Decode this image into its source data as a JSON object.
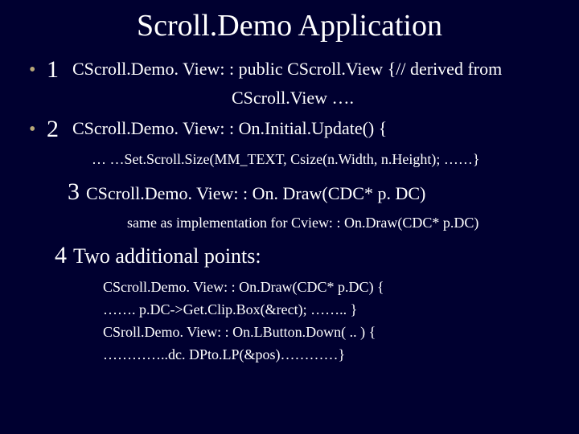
{
  "title": "Scroll.Demo Application",
  "items": {
    "i1": {
      "num": "1",
      "text": "CScroll.Demo. View: : public CScroll.View {// derived from",
      "cont": "CScroll.View …."
    },
    "i2": {
      "num": "2",
      "text": "CScroll.Demo. View: : On.Initial.Update() {",
      "sub": "… …Set.Scroll.Size(MM_TEXT, Csize(n.Width, n.Height);  ……}"
    },
    "i3": {
      "num": "3",
      "text": "CScroll.Demo. View: : On. Draw(CDC* p. DC)",
      "sub": "same as implementation for Cview: : On.Draw(CDC* p.DC)"
    },
    "i4": {
      "num": "4",
      "text": "Two additional points:",
      "lines": [
        "CScroll.Demo. View: : On.Draw(CDC* p.DC) {",
        "……. p.DC->Get.Clip.Box(&rect); …….. }",
        "CSroll.Demo. View: : On.LButton.Down( .. ) {",
        "…………..dc. DPto.LP(&pos)…………}"
      ]
    }
  }
}
